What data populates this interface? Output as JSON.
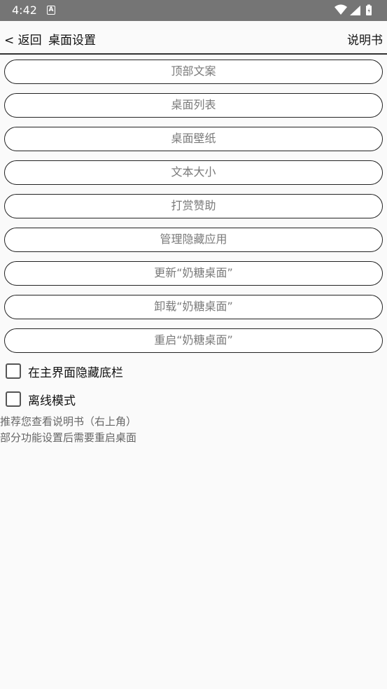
{
  "status_bar": {
    "time": "4:42",
    "notification_icon": "A"
  },
  "toolbar": {
    "back_label": "< 返回",
    "title": "桌面设置",
    "help_label": "说明书"
  },
  "menu": {
    "items": [
      "顶部文案",
      "桌面列表",
      "桌面壁纸",
      "文本大小",
      "打赏赞助",
      "管理隐藏应用",
      "更新“奶糖桌面”",
      "卸载“奶糖桌面”",
      "重启“奶糖桌面”"
    ]
  },
  "options": {
    "hide_bottom_bar": {
      "label": "在主界面隐藏底栏",
      "checked": false
    },
    "offline_mode": {
      "label": "离线模式",
      "checked": false
    }
  },
  "notes": {
    "line1": "推荐您查看说明书（右上角）",
    "line2": "部分功能设置后需要重启桌面"
  }
}
